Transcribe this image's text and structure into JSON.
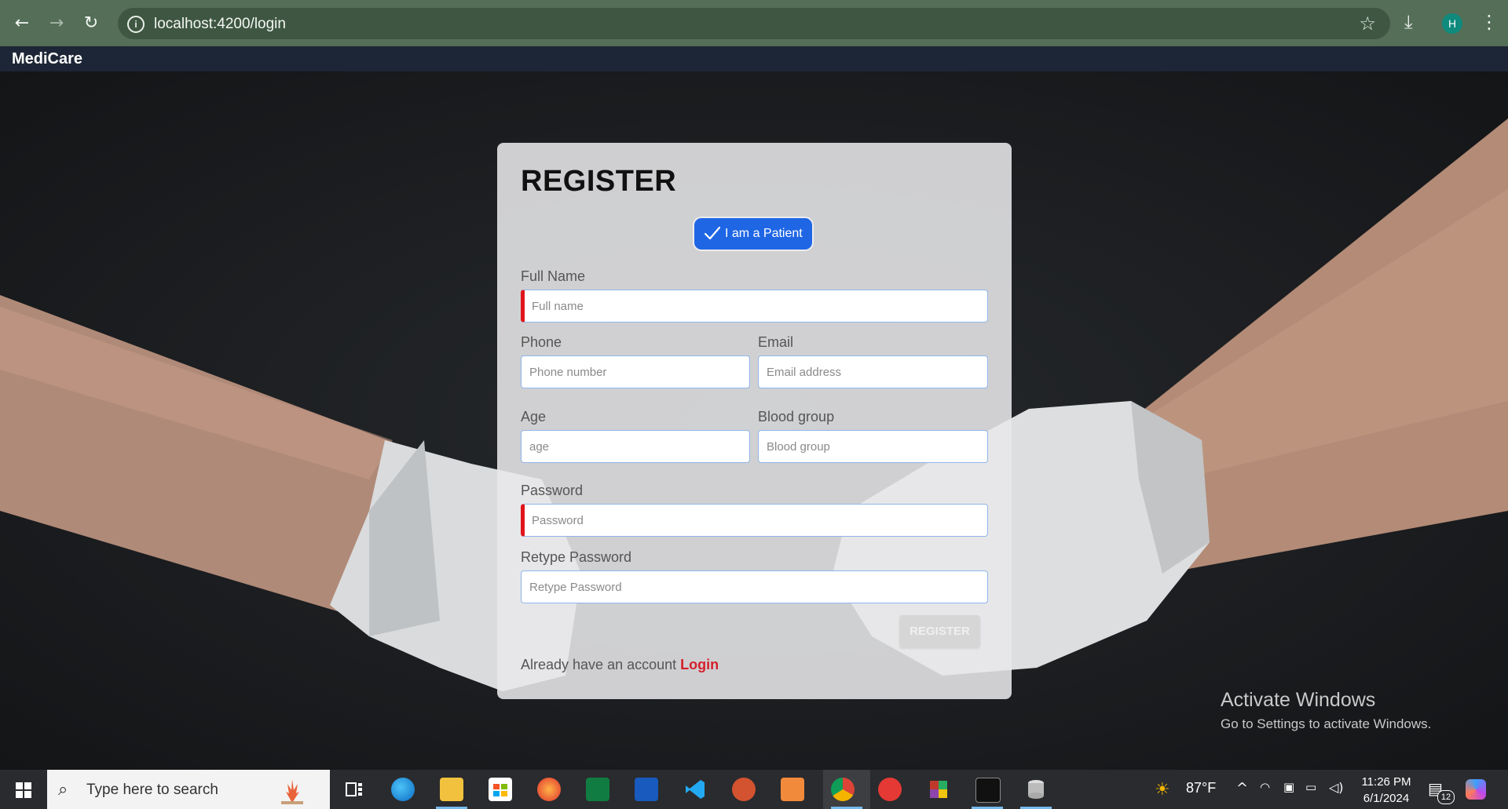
{
  "browser": {
    "url": "localhost:4200/login",
    "profile_initial": "H",
    "back_icon": "←",
    "forward_icon": "→",
    "reload_icon": "↻",
    "star_icon": "☆",
    "download_icon": "⤓",
    "menu_icon": "⋮"
  },
  "app": {
    "brand": "MediCare"
  },
  "form": {
    "title": "REGISTER",
    "patient_toggle_label": "I am a Patient",
    "full_name_label": "Full Name",
    "full_name_placeholder": "Full name",
    "phone_label": "Phone",
    "phone_placeholder": "Phone number",
    "email_label": "Email",
    "email_placeholder": "Email address",
    "age_label": "Age",
    "age_placeholder": "age",
    "blood_group_label": "Blood group",
    "blood_group_placeholder": "Blood group",
    "password_label": "Password",
    "password_placeholder": "Password",
    "retype_password_label": "Retype Password",
    "retype_password_placeholder": "Retype Password",
    "submit_label": "REGISTER",
    "footer_text": "Already have an account",
    "login_link": "Login"
  },
  "watermark": {
    "line1": "Activate Windows",
    "line2": "Go to Settings to activate Windows."
  },
  "taskbar": {
    "search_placeholder": "Type here to search",
    "weather": "87°F",
    "time": "11:26 PM",
    "date": "6/1/2024",
    "notification_count": "12"
  },
  "colors": {
    "primary": "#1f66e5",
    "invalid": "#e0141c",
    "login_link": "#d4202a",
    "navbar": "#1d2636",
    "browser_chrome": "#546e57"
  }
}
